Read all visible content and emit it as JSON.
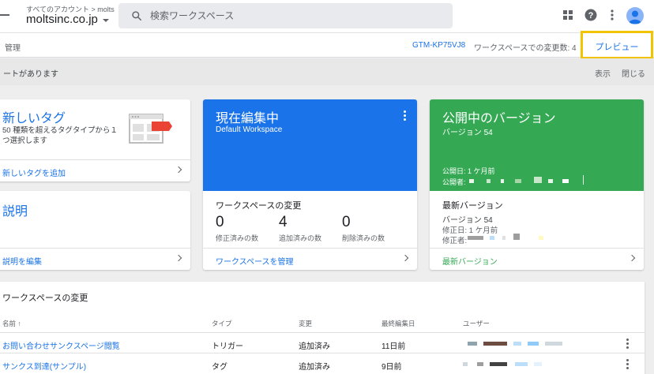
{
  "topbar": {
    "account_crumb": "すべてのアカウント > molts",
    "account_name": "moltsinc.co.jp",
    "search_placeholder": "検索ワークスペース",
    "icons": [
      "menu-icon",
      "search-icon",
      "apps-grid-icon",
      "help-icon",
      "more-vert-icon",
      "account-avatar"
    ]
  },
  "subbar": {
    "admin": "管理",
    "container_id": "GTM-KP75VJ8",
    "workspace_changes": "ワークスペースでの変更数: 4",
    "preview": "プレビュー"
  },
  "notice": {
    "text": "ートがあります",
    "show": "表示",
    "close": "閉じる"
  },
  "cards": {
    "new_tag": {
      "title": "新しいタグ",
      "description": "50 種類を超えるタグタイプから１つ選択します",
      "link": "新しいタグを追加"
    },
    "description": {
      "title": "説明",
      "link": "説明を編集"
    },
    "current_workspace": {
      "title": "現在編集中",
      "subtitle": "Default Workspace",
      "changes_title": "ワークスペースの変更",
      "stats": [
        {
          "value": "0",
          "label": "修正済みの数"
        },
        {
          "value": "4",
          "label": "追加済みの数"
        },
        {
          "value": "0",
          "label": "削除済みの数"
        }
      ],
      "link": "ワークスペースを管理"
    },
    "published": {
      "title": "公開中のバージョン",
      "version": "バージョン 54",
      "published_date": "公開日: 1 ケ月前",
      "published_by": "公開者:",
      "latest_title": "最新バージョン",
      "latest_version": "バージョン 54",
      "modified_date": "修正日: 1 ケ月前",
      "modified_by": "修正者:",
      "link": "最新バージョン"
    }
  },
  "colors": {
    "accent_blue": "#1a73e8",
    "published_green": "#34a853",
    "highlight_yellow": "#f2c300",
    "tag_red": "#ea4335"
  },
  "changes_table": {
    "title": "ワークスペースの変更",
    "headers": [
      "名前 ↑",
      "タイプ",
      "変更",
      "最終編集日",
      "ユーザー"
    ],
    "rows": [
      {
        "name": "お問い合わせサンクスページ閲覧",
        "type": "トリガー",
        "change": "追加済み",
        "edited": "11日前"
      },
      {
        "name": "サンクス到達(サンプル)",
        "type": "タグ",
        "change": "追加済み",
        "edited": "9日前"
      }
    ]
  }
}
